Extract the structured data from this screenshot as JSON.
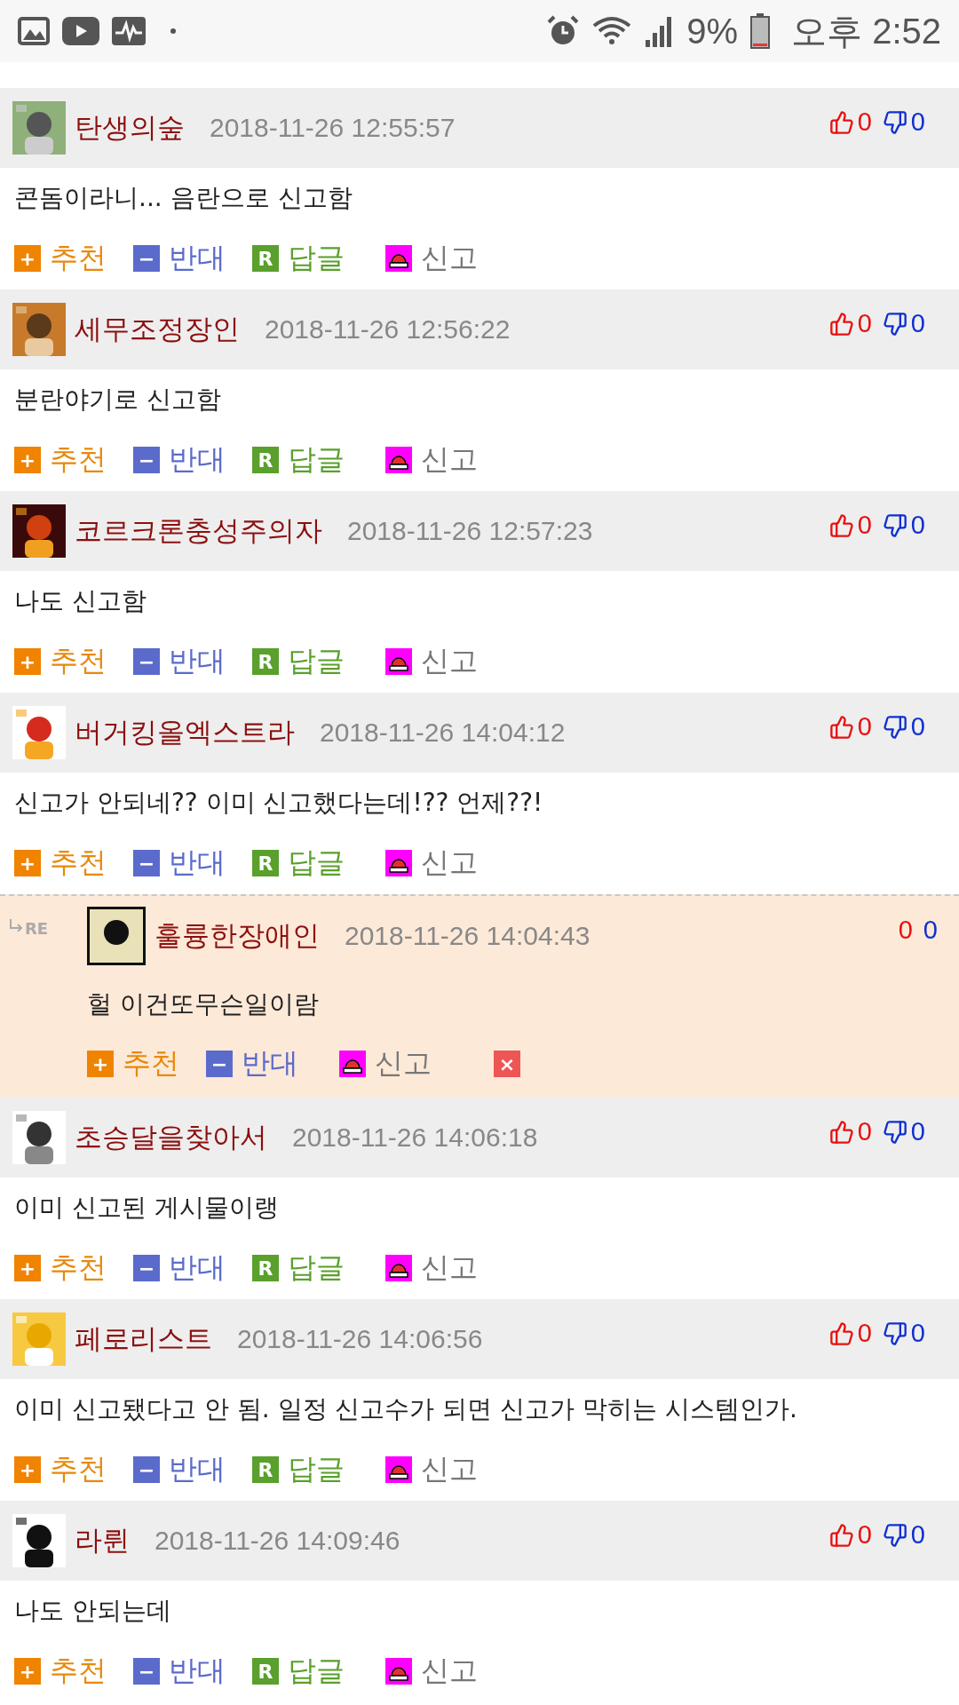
{
  "status_bar": {
    "battery": "9%",
    "time": "오후 2:52"
  },
  "comments": [
    {
      "kind": "comment",
      "nick": "탄생의숲",
      "date": "2018-11-26 12:55:57",
      "up": "0",
      "down": "0",
      "body": "콘돔이라니... 음란으로 신고함",
      "actions": [
        {
          "kind": "up",
          "icon": "+",
          "label": "추천"
        },
        {
          "kind": "down",
          "icon": "−",
          "label": "반대"
        },
        {
          "kind": "reply",
          "icon": "R",
          "label": "답글"
        },
        {
          "kind": "report",
          "label": "신고"
        }
      ]
    },
    {
      "kind": "comment",
      "nick": "세무조정장인",
      "date": "2018-11-26 12:56:22",
      "up": "0",
      "down": "0",
      "body": "분란야기로 신고함",
      "actions": [
        {
          "kind": "up",
          "icon": "+",
          "label": "추천"
        },
        {
          "kind": "down",
          "icon": "−",
          "label": "반대"
        },
        {
          "kind": "reply",
          "icon": "R",
          "label": "답글"
        },
        {
          "kind": "report",
          "label": "신고"
        }
      ]
    },
    {
      "kind": "comment",
      "nick": "코르크론충성주의자",
      "date": "2018-11-26 12:57:23",
      "up": "0",
      "down": "0",
      "body": "나도 신고함",
      "actions": [
        {
          "kind": "up",
          "icon": "+",
          "label": "추천"
        },
        {
          "kind": "down",
          "icon": "−",
          "label": "반대"
        },
        {
          "kind": "reply",
          "icon": "R",
          "label": "답글"
        },
        {
          "kind": "report",
          "label": "신고"
        }
      ]
    },
    {
      "kind": "comment",
      "nick": "버거킹올엑스트라",
      "date": "2018-11-26 14:04:12",
      "up": "0",
      "down": "0",
      "body": "신고가 안되네?? 이미 신고했다는데!?? 언제??!",
      "actions": [
        {
          "kind": "up",
          "icon": "+",
          "label": "추천"
        },
        {
          "kind": "down",
          "icon": "−",
          "label": "반대"
        },
        {
          "kind": "reply",
          "icon": "R",
          "label": "답글"
        },
        {
          "kind": "report",
          "label": "신고"
        }
      ]
    },
    {
      "kind": "reply",
      "badge": "RE",
      "nick": "훌륭한장애인",
      "date": "2018-11-26 14:04:43",
      "up": "0",
      "down": "0",
      "body": "헐 이건또무슨일이람",
      "actions": [
        {
          "kind": "up",
          "icon": "+",
          "label": "추천"
        },
        {
          "kind": "down",
          "icon": "−",
          "label": "반대"
        },
        {
          "kind": "report",
          "label": "신고"
        },
        {
          "kind": "delete",
          "icon": "×"
        }
      ]
    },
    {
      "kind": "comment",
      "nick": "초승달을찾아서",
      "date": "2018-11-26 14:06:18",
      "up": "0",
      "down": "0",
      "body": "이미 신고된 게시물이랭",
      "actions": [
        {
          "kind": "up",
          "icon": "+",
          "label": "추천"
        },
        {
          "kind": "down",
          "icon": "−",
          "label": "반대"
        },
        {
          "kind": "reply",
          "icon": "R",
          "label": "답글"
        },
        {
          "kind": "report",
          "label": "신고"
        }
      ]
    },
    {
      "kind": "comment",
      "nick": "페로리스트",
      "date": "2018-11-26 14:06:56",
      "up": "0",
      "down": "0",
      "body": "이미 신고됐다고 안 됨. 일정 신고수가 되면 신고가 막히는 시스템인가.",
      "actions": [
        {
          "kind": "up",
          "icon": "+",
          "label": "추천"
        },
        {
          "kind": "down",
          "icon": "−",
          "label": "반대"
        },
        {
          "kind": "reply",
          "icon": "R",
          "label": "답글"
        },
        {
          "kind": "report",
          "label": "신고"
        }
      ]
    },
    {
      "kind": "comment",
      "nick": "라륀",
      "date": "2018-11-26 14:09:46",
      "up": "0",
      "down": "0",
      "body": "나도 안되는데",
      "actions": [
        {
          "kind": "up",
          "icon": "+",
          "label": "추천"
        },
        {
          "kind": "down",
          "icon": "−",
          "label": "반대"
        },
        {
          "kind": "reply",
          "icon": "R",
          "label": "답글"
        },
        {
          "kind": "report",
          "label": "신고"
        }
      ]
    }
  ]
}
